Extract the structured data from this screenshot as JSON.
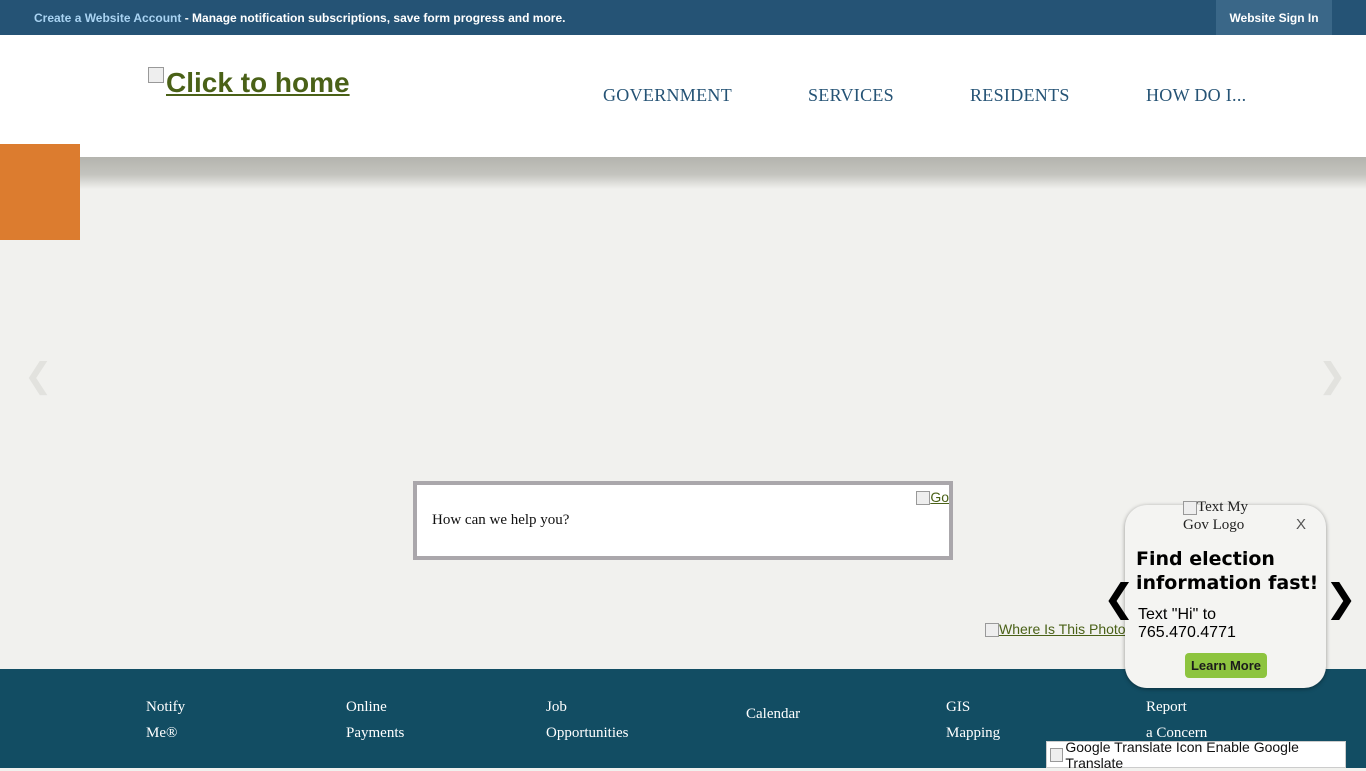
{
  "topbar": {
    "create_link": "Create a Website Account",
    "message": " - Manage notification subscriptions, save form progress and more.",
    "signin": "Website Sign In"
  },
  "logo": {
    "alt": "Click to home"
  },
  "nav": [
    "GOVERNMENT",
    "SERVICES",
    "RESIDENTS",
    "HOW DO I..."
  ],
  "search": {
    "placeholder": "How can we help you?",
    "go_alt": "Go"
  },
  "where_photo": "Where Is This Photo",
  "quick_links": [
    {
      "line1": "Notify",
      "line2": "Me®"
    },
    {
      "line1": "Online",
      "line2": "Payments"
    },
    {
      "line1": "Job",
      "line2": "Opportunities"
    },
    {
      "line1": "Calendar",
      "line2": ""
    },
    {
      "line1": "GIS",
      "line2": "Mapping"
    },
    {
      "line1": "Report",
      "line2": "a Concern"
    }
  ],
  "popup": {
    "logo_alt_1": "Text My",
    "logo_alt_2": "Gov Logo",
    "close": "X",
    "heading": "Find election information fast!",
    "text_1": "Text \"Hi\" to",
    "text_2": "765.470.4771",
    "button": "Learn More"
  },
  "arrows": {
    "prev": "❮",
    "next": "❯"
  },
  "translate": "Google Translate Icon Enable Google Translate",
  "colors": {
    "topbar": "#255375",
    "footer": "#124d63",
    "accent": "#dc7c2f",
    "link": "#4a6117",
    "button": "#8dc43f"
  }
}
